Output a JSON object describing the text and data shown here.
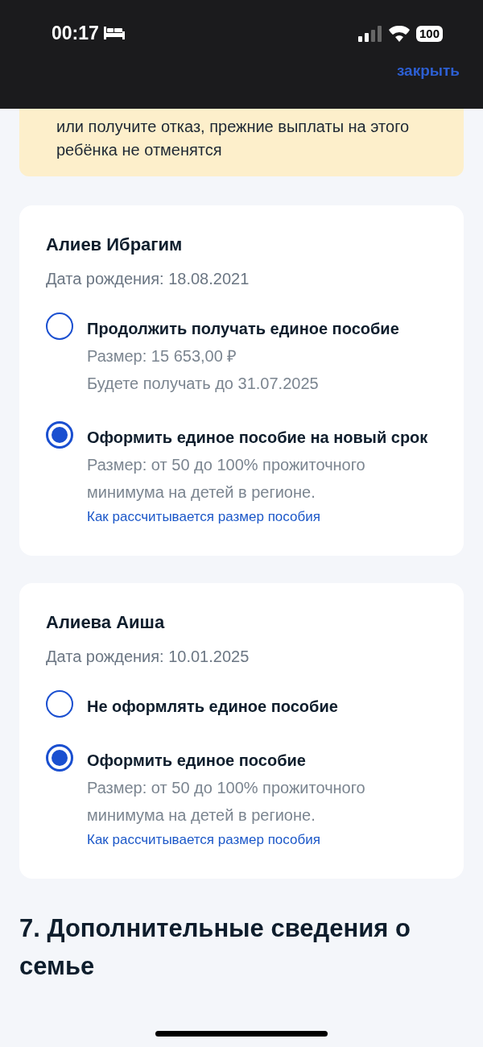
{
  "status_bar": {
    "time": "00:17",
    "battery": "100"
  },
  "header": {
    "close_link": "закрыть"
  },
  "notice": {
    "text": "или получите отказ, прежние выплаты на этого ребёнка не отменятся"
  },
  "children": [
    {
      "name": "Алиев Ибрагим",
      "birth_date": "Дата рождения: 18.08.2021",
      "options": [
        {
          "label": "Продолжить получать единое пособие",
          "selected": false,
          "details": [
            "Размер: 15 653,00 ₽",
            "Будете получать до 31.07.2025"
          ]
        },
        {
          "label": "Оформить единое пособие на новый срок",
          "selected": true,
          "details": [
            "Размер: от 50 до 100% прожиточного минимума на детей в регионе."
          ],
          "link": "Как рассчитывается размер пособия"
        }
      ]
    },
    {
      "name": "Алиева Аиша",
      "birth_date": "Дата рождения: 10.01.2025",
      "options": [
        {
          "label": "Не оформлять единое пособие",
          "selected": false
        },
        {
          "label": "Оформить единое пособие",
          "selected": true,
          "details": [
            "Размер: от 50 до 100% прожиточного минимума на детей в регионе."
          ],
          "link": "Как рассчитывается размер пособия"
        }
      ]
    }
  ],
  "section_heading": "7. Дополнительные сведения о семье"
}
